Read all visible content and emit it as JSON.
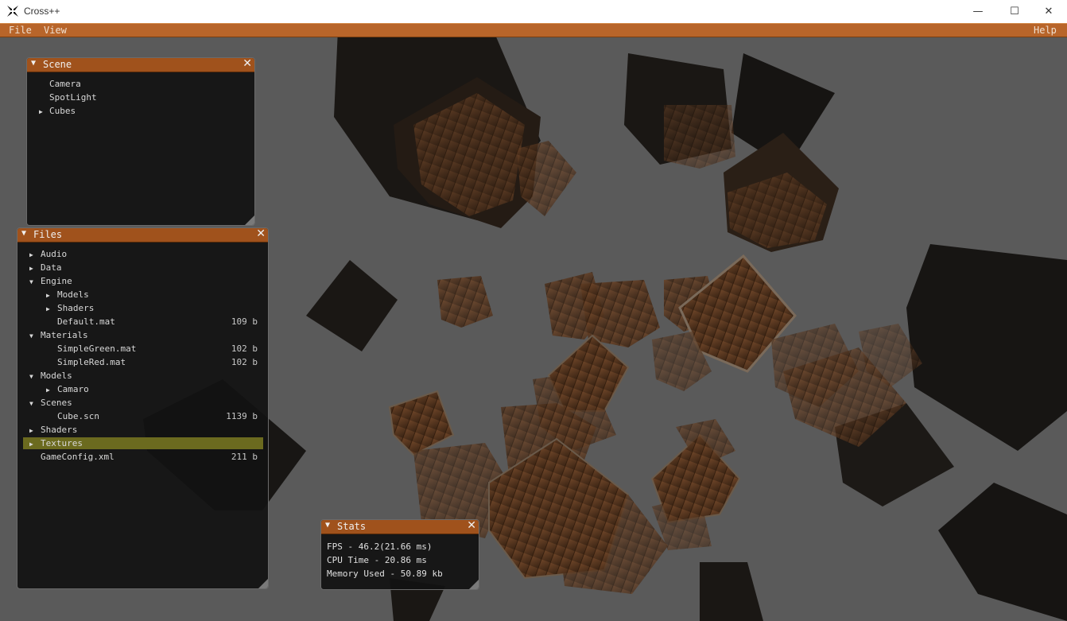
{
  "window": {
    "title": "Cross++",
    "minimize": "—",
    "maximize": "☐",
    "close": "✕"
  },
  "menu": {
    "file": "File",
    "view": "View",
    "help": "Help"
  },
  "scene_panel": {
    "title": "Scene",
    "items": [
      {
        "label": "Camera",
        "expandable": false
      },
      {
        "label": "SpotLight",
        "expandable": false
      },
      {
        "label": "Cubes",
        "expandable": true
      }
    ]
  },
  "files_panel": {
    "title": "Files",
    "items": [
      {
        "label": "Audio",
        "state": "collapsed",
        "size": ""
      },
      {
        "label": "Data",
        "state": "collapsed",
        "size": ""
      },
      {
        "label": "Engine",
        "state": "expanded",
        "size": ""
      },
      {
        "label": "Models",
        "state": "collapsed",
        "size": ""
      },
      {
        "label": "Shaders",
        "state": "collapsed",
        "size": ""
      },
      {
        "label": "Default.mat",
        "state": "file",
        "size": "109 b"
      },
      {
        "label": "Materials",
        "state": "expanded",
        "size": ""
      },
      {
        "label": "SimpleGreen.mat",
        "state": "file",
        "size": "102 b"
      },
      {
        "label": "SimpleRed.mat",
        "state": "file",
        "size": "102 b"
      },
      {
        "label": "Models",
        "state": "expanded",
        "size": ""
      },
      {
        "label": "Camaro",
        "state": "collapsed",
        "size": ""
      },
      {
        "label": "Scenes",
        "state": "expanded",
        "size": ""
      },
      {
        "label": "Cube.scn",
        "state": "file",
        "size": "1139 b"
      },
      {
        "label": "Shaders",
        "state": "collapsed",
        "size": ""
      },
      {
        "label": "Textures",
        "state": "collapsed",
        "size": ""
      },
      {
        "label": "GameConfig.xml",
        "state": "file",
        "size": "211 b"
      }
    ],
    "selected_index": 14
  },
  "stats_panel": {
    "title": "Stats",
    "fps": "FPS - 46.2(21.66 ms)",
    "cpu": "CPU Time - 20.86 ms",
    "memory": "Memory Used - 50.89 kb"
  },
  "colors": {
    "accent": "#a0521c",
    "menubar": "#b8652a",
    "selection": "#6b6a1f",
    "viewport_bg": "#5a5a5a"
  }
}
